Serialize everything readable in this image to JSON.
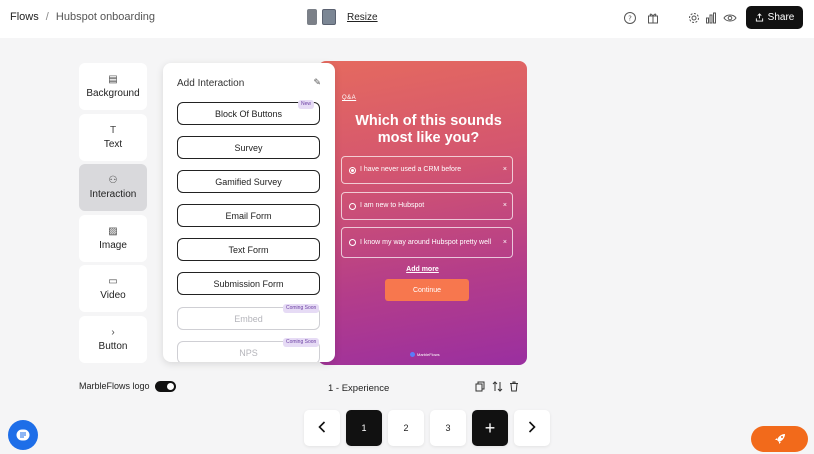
{
  "breadcrumb": {
    "root": "Flows",
    "separator": "/",
    "current": "Hubspot onboarding"
  },
  "resize": {
    "label": "Resize"
  },
  "header": {
    "share_label": "Share",
    "share_icon": "upload-icon"
  },
  "tools": [
    {
      "label": "Background",
      "icon": "background-icon",
      "glyph": "▤"
    },
    {
      "label": "Text",
      "icon": "text-icon",
      "glyph": "T"
    },
    {
      "label": "Interaction",
      "icon": "interaction-icon",
      "glyph": "⚇"
    },
    {
      "label": "Image",
      "icon": "image-icon",
      "glyph": "▨"
    },
    {
      "label": "Video",
      "icon": "video-icon",
      "glyph": "▭"
    },
    {
      "label": "Button",
      "icon": "button-icon",
      "glyph": "›"
    }
  ],
  "panel": {
    "title": "Add Interaction",
    "options": [
      {
        "label": "Block Of Buttons",
        "badge": "New"
      },
      {
        "label": "Survey"
      },
      {
        "label": "Gamified Survey"
      },
      {
        "label": "Email Form"
      },
      {
        "label": "Text Form"
      },
      {
        "label": "Submission Form"
      },
      {
        "label": "Embed",
        "badge": "Coming Soon"
      },
      {
        "label": "NPS",
        "badge": "Coming Soon"
      }
    ]
  },
  "preview": {
    "tag": "Q&A",
    "headline": "Which of this sounds most like you?",
    "answers": [
      {
        "text": "I have never used a CRM before",
        "selected": true
      },
      {
        "text": "I am new to Hubspot",
        "selected": false
      },
      {
        "text": "I know my way around Hubspot pretty well",
        "selected": false
      }
    ],
    "add_more": "Add more",
    "continue": "Continue",
    "brand": "MarbleFlows"
  },
  "footer": {
    "logo_toggle_label": "MarbleFlows logo",
    "experience_label": "1 - Experience"
  },
  "pager": {
    "pages": [
      "1",
      "2",
      "3"
    ],
    "current": "1",
    "add": "+"
  },
  "colors": {
    "accent": "#f26a1b",
    "gradient_top": "#e56a5f",
    "gradient_bottom": "#9a2fa0",
    "chat": "#1e6ee8"
  }
}
